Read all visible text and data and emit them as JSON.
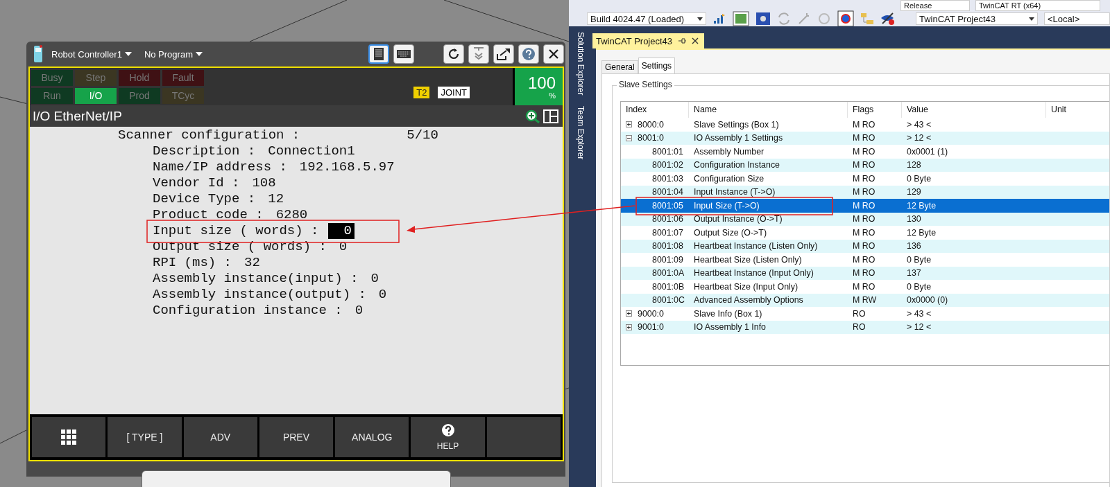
{
  "pendant": {
    "controller": "Robot Controller1",
    "program": "No Program",
    "status_lamps": [
      {
        "label": "Busy",
        "color": "#0f3a22",
        "on": false
      },
      {
        "label": "Step",
        "color": "#3b3622",
        "on": false
      },
      {
        "label": "Hold",
        "color": "#3f1114",
        "on": false
      },
      {
        "label": "Fault",
        "color": "#3f1114",
        "on": false
      },
      {
        "label": "Run",
        "color": "#0f3a22",
        "on": false
      },
      {
        "label": "I/O",
        "color": "#16a34a",
        "on": true
      },
      {
        "label": "Prod",
        "color": "#0f3a22",
        "on": false
      },
      {
        "label": "TCyc",
        "color": "#3b3622",
        "on": false
      }
    ],
    "mode": "T2",
    "coord": "JOINT",
    "override": "100",
    "override_unit": "%",
    "screen_title": "I/O EtherNet/IP",
    "lines": [
      {
        "kind": "heading",
        "label": "Scanner configuration :",
        "value": "5/10",
        "selected": false
      },
      {
        "kind": "field",
        "label": "Description :",
        "value": "Connection1",
        "selected": false
      },
      {
        "kind": "field",
        "label": "Name/IP address :",
        "value": "192.168.5.97",
        "selected": false
      },
      {
        "kind": "field",
        "label": "Vendor Id :",
        "value": "108",
        "selected": false
      },
      {
        "kind": "field",
        "label": "Device Type :",
        "value": "12",
        "selected": false
      },
      {
        "kind": "field",
        "label": "Product code :",
        "value": "6280",
        "selected": false
      },
      {
        "kind": "field",
        "label": "Input size ( words) :",
        "value": "0",
        "selected": true
      },
      {
        "kind": "field",
        "label": "Output size ( words) :",
        "value": "0",
        "selected": false
      },
      {
        "kind": "field",
        "label": "RPI (ms) :",
        "value": "32",
        "selected": false
      },
      {
        "kind": "field",
        "label": "Assembly instance(input) :",
        "value": "0",
        "selected": false
      },
      {
        "kind": "field",
        "label": "Assembly instance(output) :",
        "value": "0",
        "selected": false
      },
      {
        "kind": "field",
        "label": "Configuration instance :",
        "value": "0",
        "selected": false
      }
    ],
    "function_keys": [
      {
        "kind": "menu"
      },
      {
        "kind": "text",
        "label": "[ TYPE ]"
      },
      {
        "kind": "text",
        "label": "ADV"
      },
      {
        "kind": "text",
        "label": "PREV"
      },
      {
        "kind": "text",
        "label": "ANALOG"
      },
      {
        "kind": "help",
        "label": "HELP"
      },
      {
        "kind": "blank"
      }
    ]
  },
  "ide": {
    "toolbar_top": [
      "Release",
      "TwinCAT RT (x64)"
    ],
    "build": "Build 4024.47 (Loaded)",
    "project": "TwinCAT Project43",
    "target": "<Local>",
    "side_tabs": [
      "Solution Explorer",
      "Team Explorer"
    ],
    "doc_tab": "TwinCAT Project43",
    "tabs": [
      {
        "label": "General",
        "selected": false
      },
      {
        "label": "Settings",
        "selected": true
      }
    ],
    "group": "Slave Settings",
    "columns": [
      "Index",
      "Name",
      "Flags",
      "Value",
      "Unit"
    ],
    "rows": [
      {
        "index": "8000:0",
        "name": "Slave Settings (Box 1)",
        "flags": "M RO",
        "value": "> 43 <",
        "expanded": false,
        "selected": false
      },
      {
        "index": "8001:0",
        "name": "IO Assembly 1 Settings",
        "flags": "M RO",
        "value": "> 12 <",
        "expanded": true,
        "selected": false,
        "children": [
          {
            "index": "8001:01",
            "name": "Assembly Number",
            "flags": "M RO",
            "value": "0x0001 (1)",
            "selected": false
          },
          {
            "index": "8001:02",
            "name": "Configuration Instance",
            "flags": "M RO",
            "value": "128",
            "selected": false
          },
          {
            "index": "8001:03",
            "name": "Configuration Size",
            "flags": "M RO",
            "value": "0 Byte",
            "selected": false
          },
          {
            "index": "8001:04",
            "name": "Input Instance (T->O)",
            "flags": "M RO",
            "value": "129",
            "selected": false
          },
          {
            "index": "8001:05",
            "name": "Input Size (T->O)",
            "flags": "M RO",
            "value": "12 Byte",
            "selected": true
          },
          {
            "index": "8001:06",
            "name": "Output Instance (O->T)",
            "flags": "M RO",
            "value": "130",
            "selected": false
          },
          {
            "index": "8001:07",
            "name": "Output Size (O->T)",
            "flags": "M RO",
            "value": "12 Byte",
            "selected": false
          },
          {
            "index": "8001:08",
            "name": "Heartbeat Instance (Listen Only)",
            "flags": "M RO",
            "value": "136",
            "selected": false
          },
          {
            "index": "8001:09",
            "name": "Heartbeat Size (Listen Only)",
            "flags": "M RO",
            "value": "0 Byte",
            "selected": false
          },
          {
            "index": "8001:0A",
            "name": "Heartbeat Instance (Input Only)",
            "flags": "M RO",
            "value": "137",
            "selected": false
          },
          {
            "index": "8001:0B",
            "name": "Heartbeat Size (Input Only)",
            "flags": "M RO",
            "value": "0 Byte",
            "selected": false
          },
          {
            "index": "8001:0C",
            "name": "Advanced Assembly Options",
            "flags": "M RW",
            "value": "0x0000 (0)",
            "selected": false
          }
        ]
      },
      {
        "index": "9000:0",
        "name": "Slave Info (Box 1)",
        "flags": "RO",
        "value": "> 43 <",
        "expanded": false,
        "selected": false
      },
      {
        "index": "9001:0",
        "name": "IO Assembly 1 Info",
        "flags": "RO",
        "value": "> 12 <",
        "expanded": false,
        "selected": false
      }
    ]
  }
}
